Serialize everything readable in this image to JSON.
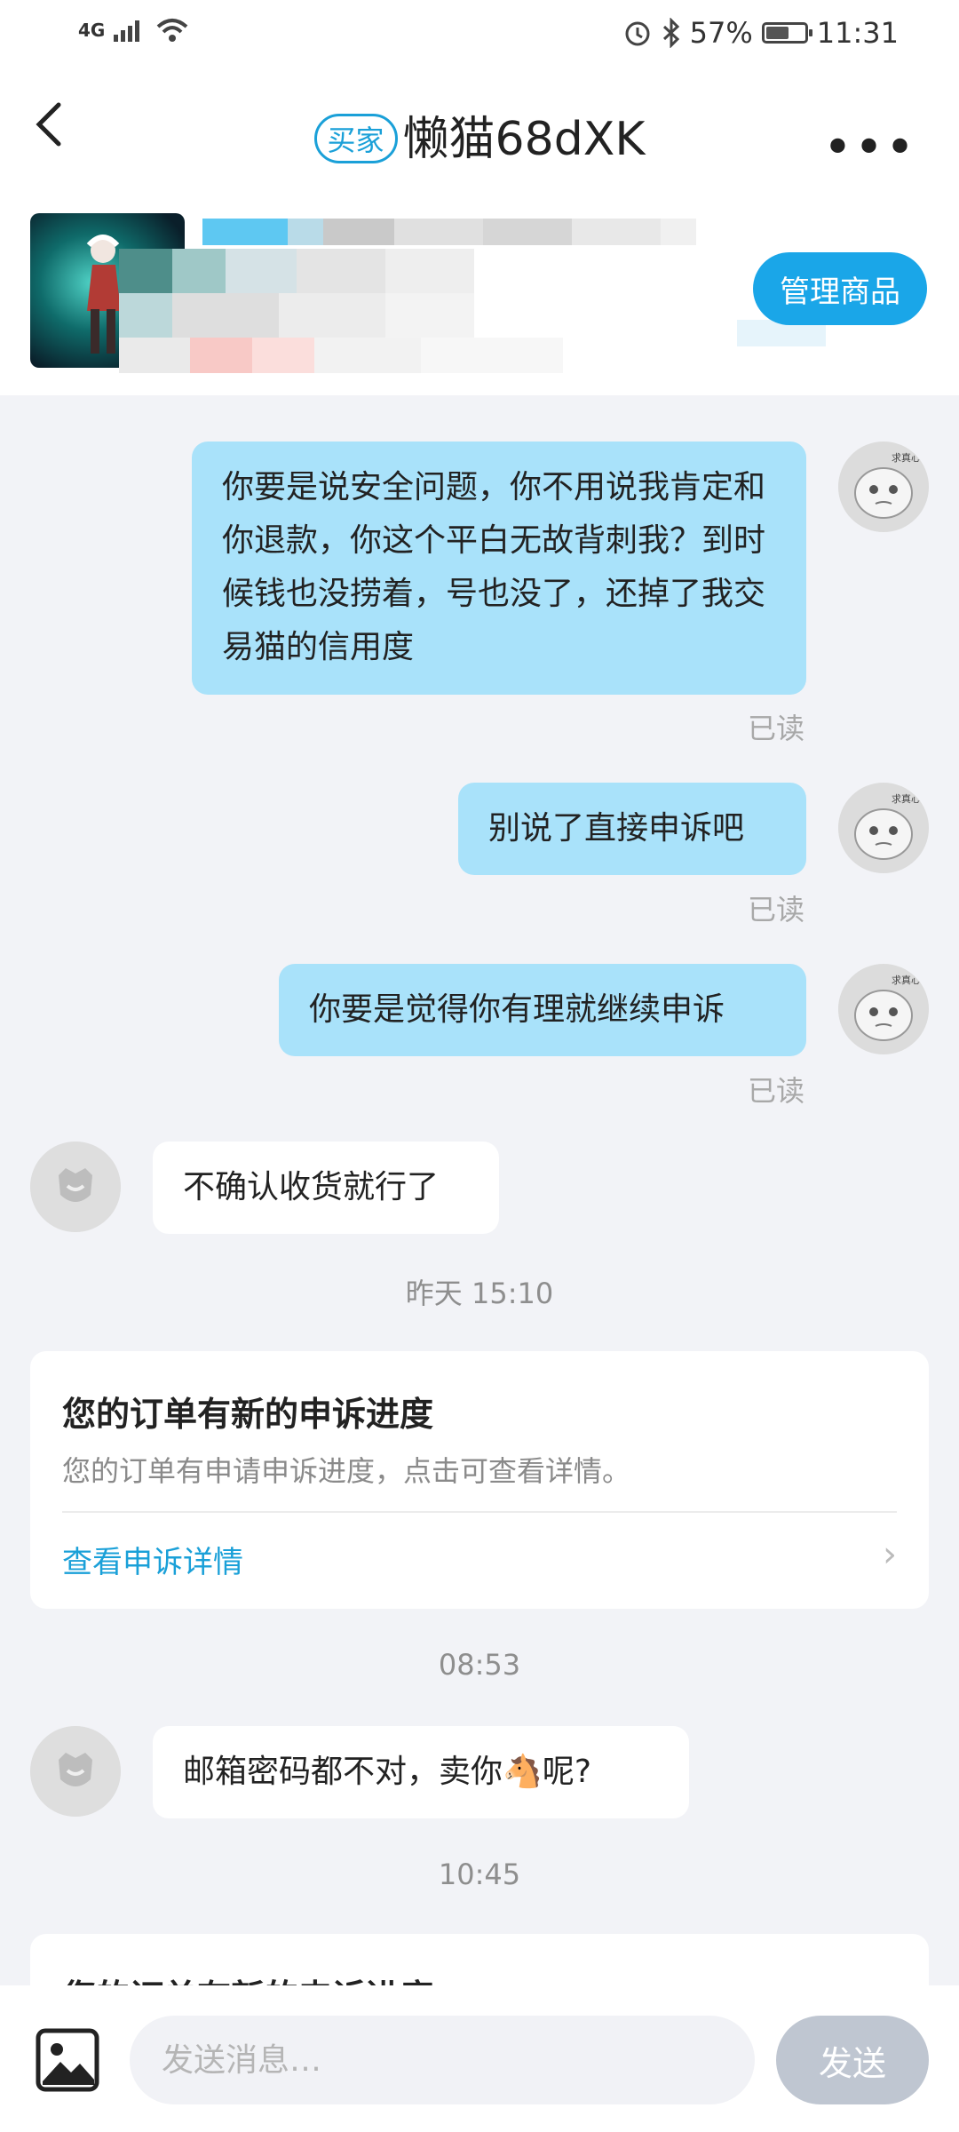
{
  "status_bar": {
    "network": "4G",
    "battery": "57%",
    "battery_level": 0.57,
    "time": "11:31"
  },
  "header": {
    "badge": "买家",
    "title": "懒猫68dXK",
    "more": "•••"
  },
  "product": {
    "manage_label": "管理商品"
  },
  "messages": [
    {
      "side": "out",
      "text": "你要是说安全问题，你不用说我肯定和你退款，你这个平白无故背刺我？到时候钱也没捞着，号也没了，还掉了我交易猫的信用度",
      "status": "已读"
    },
    {
      "side": "out",
      "text": "别说了直接申诉吧",
      "status": "已读"
    },
    {
      "side": "out",
      "text": "你要是觉得你有理就继续申诉",
      "status": "已读"
    },
    {
      "side": "in",
      "text": "不确认收货就行了"
    }
  ],
  "timestamps": [
    "昨天 15:10",
    "08:53",
    "10:45"
  ],
  "appeal_card": {
    "title": "您的订单有新的申诉进度",
    "desc": "您的订单有申请申诉进度，点击可查看详情。",
    "link": "查看申诉详情"
  },
  "message_after": {
    "side": "in",
    "text_before": "邮箱密码都不对，卖你",
    "emoji": "🐴",
    "text_after": "呢?"
  },
  "input": {
    "placeholder": "发送消息…",
    "send_label": "发送"
  },
  "colors": {
    "accent": "#1aa0d8",
    "outgoing_bubble": "#a9e2fa",
    "background": "#f2f3f7"
  }
}
